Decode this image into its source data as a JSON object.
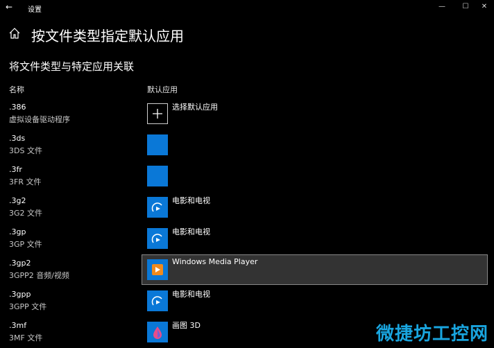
{
  "window": {
    "title": "设置",
    "back_icon": "back-arrow-icon",
    "minimize": "—",
    "maximize": "☐",
    "close": "✕"
  },
  "header": {
    "home_icon": "home-icon",
    "title": "按文件类型指定默认应用"
  },
  "section": {
    "title": "将文件类型与特定应用关联",
    "col_name": "名称",
    "col_app": "默认应用"
  },
  "rows": [
    {
      "ext": ".386",
      "desc": "虚拟设备驱动程序",
      "app": "选择默认应用",
      "icon": "plus-icon"
    },
    {
      "ext": ".3ds",
      "desc": "3DS 文件",
      "app": "",
      "icon": "blank-app-icon"
    },
    {
      "ext": ".3fr",
      "desc": "3FR 文件",
      "app": "",
      "icon": "blank-app-icon"
    },
    {
      "ext": ".3g2",
      "desc": "3G2 文件",
      "app": "电影和电视",
      "icon": "movies-tv-icon"
    },
    {
      "ext": ".3gp",
      "desc": "3GP 文件",
      "app": "电影和电视",
      "icon": "movies-tv-icon"
    },
    {
      "ext": ".3gp2",
      "desc": "3GPP2 音频/视频",
      "app": "Windows Media Player",
      "icon": "media-player-icon",
      "selected": true
    },
    {
      "ext": ".3gpp",
      "desc": "3GPP 文件",
      "app": "电影和电视",
      "icon": "movies-tv-icon"
    },
    {
      "ext": ".3mf",
      "desc": "3MF 文件",
      "app": "画图 3D",
      "icon": "paint-3d-icon"
    }
  ],
  "watermark": "微捷坊工控网",
  "colors": {
    "accent": "#0a78d7",
    "background": "#000000",
    "watermark": "#19a5df"
  }
}
